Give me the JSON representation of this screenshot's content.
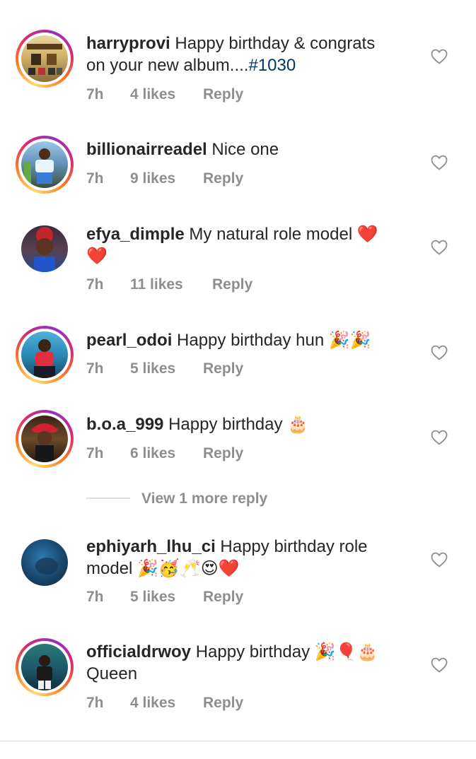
{
  "comments": [
    {
      "username": "harryprovi",
      "text": " Happy birthday & congrats on your new album....",
      "tag": "#1030",
      "time": "7h",
      "likes": "4 likes",
      "reply": "Reply"
    },
    {
      "username": "billionairreadel",
      "text": " Nice one",
      "tag": "",
      "time": "7h",
      "likes": "9 likes",
      "reply": "Reply"
    },
    {
      "username": "efya_dimple",
      "text": " My natural role model ",
      "emoji": "❤️❤️",
      "time": "7h",
      "likes": "11 likes",
      "reply": "Reply"
    },
    {
      "username": "pearl_odoi",
      "text": " Happy birthday hun ",
      "emoji": "🎉🎉",
      "time": "7h",
      "likes": "5 likes",
      "reply": "Reply"
    },
    {
      "username": "b.o.a_999",
      "text": " Happy birthday ",
      "emoji": "🎂",
      "time": "7h",
      "likes": "6 likes",
      "reply": "Reply"
    },
    {
      "username": "ephiyarh_lhu_ci",
      "text": " Happy birthday role model ",
      "emoji": "🎉🥳🥂😍❤️",
      "time": "7h",
      "likes": "5 likes",
      "reply": "Reply"
    },
    {
      "username": "officialdrwoy",
      "text": " Happy birthday ",
      "emoji": "🎉🎈🎂",
      "text2": " Queen",
      "time": "7h",
      "likes": "4 likes",
      "reply": "Reply"
    }
  ],
  "view_more": "View 1 more reply",
  "icons": {
    "like": "heart-outline-icon"
  },
  "colors": {
    "text": "#262626",
    "secondary": "#8e8e8e",
    "link": "#00376b"
  }
}
